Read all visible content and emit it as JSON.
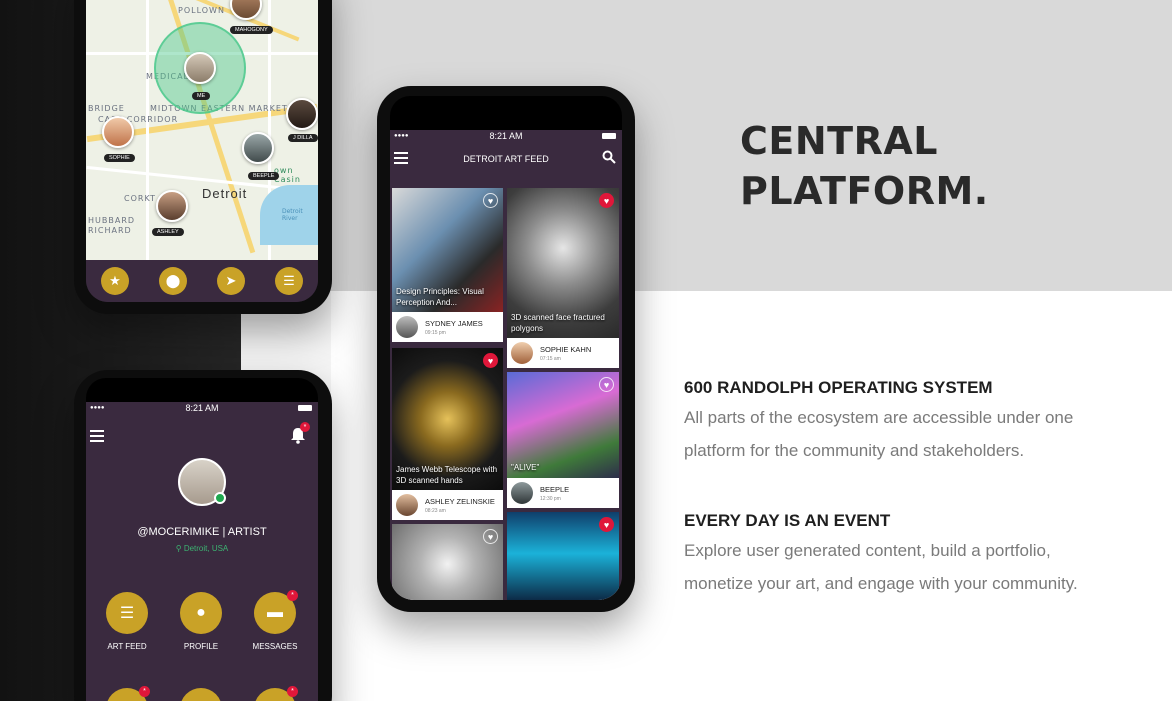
{
  "headline": "CENTRAL PLATFORM.",
  "features": [
    {
      "title": "600 RANDOLPH OPERATING SYSTEM",
      "body": "All parts of the ecosystem are accessible under one platform for the community and stakeholders."
    },
    {
      "title": "EVERY DAY IS AN EVENT",
      "body": "Explore user generated content, build a portfolio, monetize your art, and engage with your community."
    }
  ],
  "map_screen": {
    "labels": {
      "pollown": "POLLOWN",
      "mahogony": "MAHOGONY",
      "midtown": "MIDTOWN  EASTERN MARKET",
      "bridge": "BRIDGE",
      "cass": "CASS CORRIDOR",
      "corkt": "CORKT",
      "hubbard": "HUBBARD",
      "richard": "RICHARD",
      "detroit": "Detroit",
      "medical": "MEDICAL",
      "casino": "own Casin",
      "water": "Detroit River"
    },
    "pins": {
      "me": "ME",
      "sophie": "SOPHIE",
      "beeple": "BEEPLE",
      "ashley": "ASHLEY",
      "jdilla": "J DILLA"
    },
    "nav_icons": [
      "star-icon",
      "location-pin-icon",
      "navigation-icon",
      "list-icon"
    ],
    "nav_glyphs": [
      "★",
      "⬤",
      "➤",
      "☰"
    ]
  },
  "feed_screen": {
    "time": "8:21 AM",
    "title": "DETROIT ART FEED",
    "cards": [
      {
        "caption": "Design Principles: Visual Perception And...",
        "name": "SYDNEY JAMES",
        "time": "09:15 pm",
        "liked": false
      },
      {
        "caption": "3D scanned face fractured polygons",
        "name": "SOPHIE KAHN",
        "time": "07:15 am",
        "liked": true
      },
      {
        "caption": "James Webb Telescope with 3D scanned hands",
        "name": "ASHLEY ZELINSKIE",
        "time": "08:23 am",
        "liked": true
      },
      {
        "caption": "\"ALIVE\"",
        "name": "BEEPLE",
        "time": "12:30 pm",
        "liked": false
      },
      {
        "caption": "",
        "name": "",
        "time": "",
        "liked": false
      },
      {
        "caption": "",
        "name": "",
        "time": "",
        "liked": true
      }
    ]
  },
  "profile_screen": {
    "time": "8:21 AM",
    "handle": "@MOCERIMIKE | ARTIST",
    "location": "Detroit, USA",
    "tiles": [
      {
        "label": "ART FEED",
        "icon": "list-icon",
        "glyph": "☰",
        "badge": false
      },
      {
        "label": "PROFILE",
        "icon": "person-icon",
        "glyph": "●",
        "badge": false
      },
      {
        "label": "MESSAGES",
        "icon": "chat-icon",
        "glyph": "▬",
        "badge": true
      }
    ],
    "badge_mark": "*"
  }
}
